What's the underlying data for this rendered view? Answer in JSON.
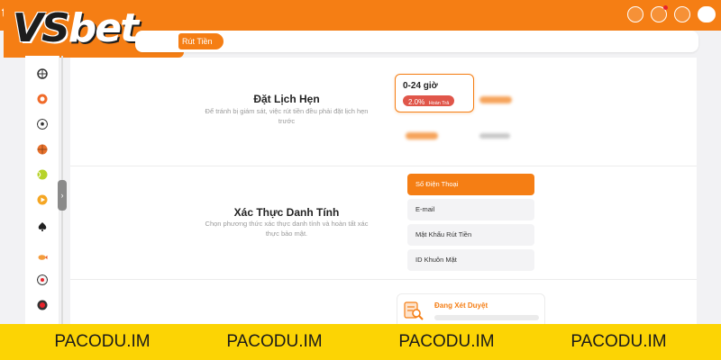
{
  "header": {
    "edge_letter": "t",
    "icons": [
      "wallet-icon",
      "bell-icon",
      "headset-icon",
      "vip-avatar"
    ]
  },
  "logo": {
    "part1": "VS",
    "part2": "bet"
  },
  "breadcrumb": {
    "current": "Rút Tiền"
  },
  "sidebar": {
    "items": [
      "wheel-icon",
      "casino-chip-icon",
      "soccer-ball-icon",
      "basketball-icon",
      "tennis-ball-icon",
      "play-icon",
      "spade-icon",
      "fish-icon",
      "lottery-icon",
      "cockfight-icon"
    ]
  },
  "schedule": {
    "title": "Đặt Lịch Hẹn",
    "description": "Để tránh bị giám sát, việc rút tiền đều phải đặt lịch hẹn trước",
    "selected_slot": {
      "time": "0-24 giờ",
      "badge_pct": "2.0%",
      "badge_label": "Hoàn Trả"
    }
  },
  "identity": {
    "title": "Xác Thực Danh Tính",
    "description": "Chọn phương thức xác thực danh tính và hoàn tất xác thực bảo mật.",
    "methods": [
      "Số Điện Thoại",
      "E-mail",
      "Mật Khẩu Rút Tiền",
      "ID Khuôn Mặt"
    ]
  },
  "review": {
    "status": "Đang Xét Duyệt"
  },
  "watermark": {
    "text": "PACODU.IM"
  },
  "colors": {
    "brand": "#f57e14",
    "badge": "#e0564a",
    "watermark_bg": "#fcd404"
  }
}
